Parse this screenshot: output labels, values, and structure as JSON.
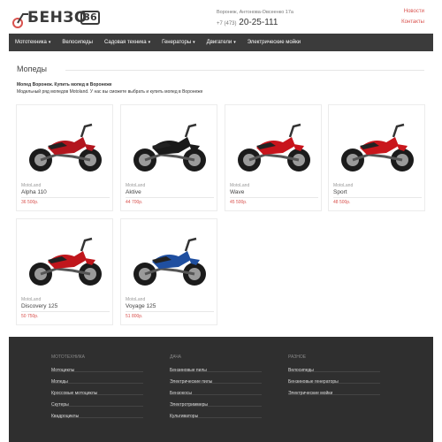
{
  "header": {
    "logo_text": "БЕНЗО",
    "logo_number": "36",
    "address": "Воронеж, Антонова-Овсеенко 17а",
    "phone_code": "+7 (473)",
    "phone": "20-25-111",
    "links": [
      "Новости",
      "Контакты"
    ]
  },
  "nav": {
    "items": [
      {
        "label": "Мототехника",
        "dropdown": true
      },
      {
        "label": "Велосипеды",
        "dropdown": false
      },
      {
        "label": "Садовая техника",
        "dropdown": true
      },
      {
        "label": "Генераторы",
        "dropdown": true
      },
      {
        "label": "Двигатели",
        "dropdown": true
      },
      {
        "label": "Электрические мойки",
        "dropdown": false
      }
    ]
  },
  "page": {
    "title": "Мопеды",
    "intro_bold": "Мопед Воронеж. Купить мопед в Воронеже",
    "intro_text": "Модельный ряд мопедов Motoland. У нас вы сможете выбрать и купить мопед в Воронеже"
  },
  "products": [
    {
      "maker": "MotoLand",
      "model": "Alpha 110",
      "price": "36 500р.",
      "color": "#b3161e"
    },
    {
      "maker": "MotoLand",
      "model": "Aktive",
      "price": "44 700р.",
      "color": "#1a1a1a"
    },
    {
      "maker": "MotoLand",
      "model": "Wave",
      "price": "45 500р.",
      "color": "#c8141c"
    },
    {
      "maker": "MotoLand",
      "model": "Sport",
      "price": "48 500р.",
      "color": "#c9161c"
    },
    {
      "maker": "MotoLand",
      "model": "Discovery 125",
      "price": "50 750р.",
      "color": "#c0161c"
    },
    {
      "maker": "MotoLand",
      "model": "Voyage 125",
      "price": "51 800р.",
      "color": "#1f4fa0"
    }
  ],
  "footer": {
    "columns": [
      {
        "heading": "Мототехника",
        "items": [
          "Мотоциклы",
          "Мопеды",
          "Кроссовые мотоциклы",
          "Скутеры",
          "Квадроциклы"
        ]
      },
      {
        "heading": "Дача",
        "items": [
          "Бензиновые пилы",
          "Электрические пилы",
          "Бензокосы",
          "Электротриммеры",
          "Культиваторы"
        ]
      },
      {
        "heading": "Разное",
        "items": [
          "Велосипеды",
          "Бензиновые генераторы",
          "Электрические мойки"
        ]
      }
    ]
  }
}
